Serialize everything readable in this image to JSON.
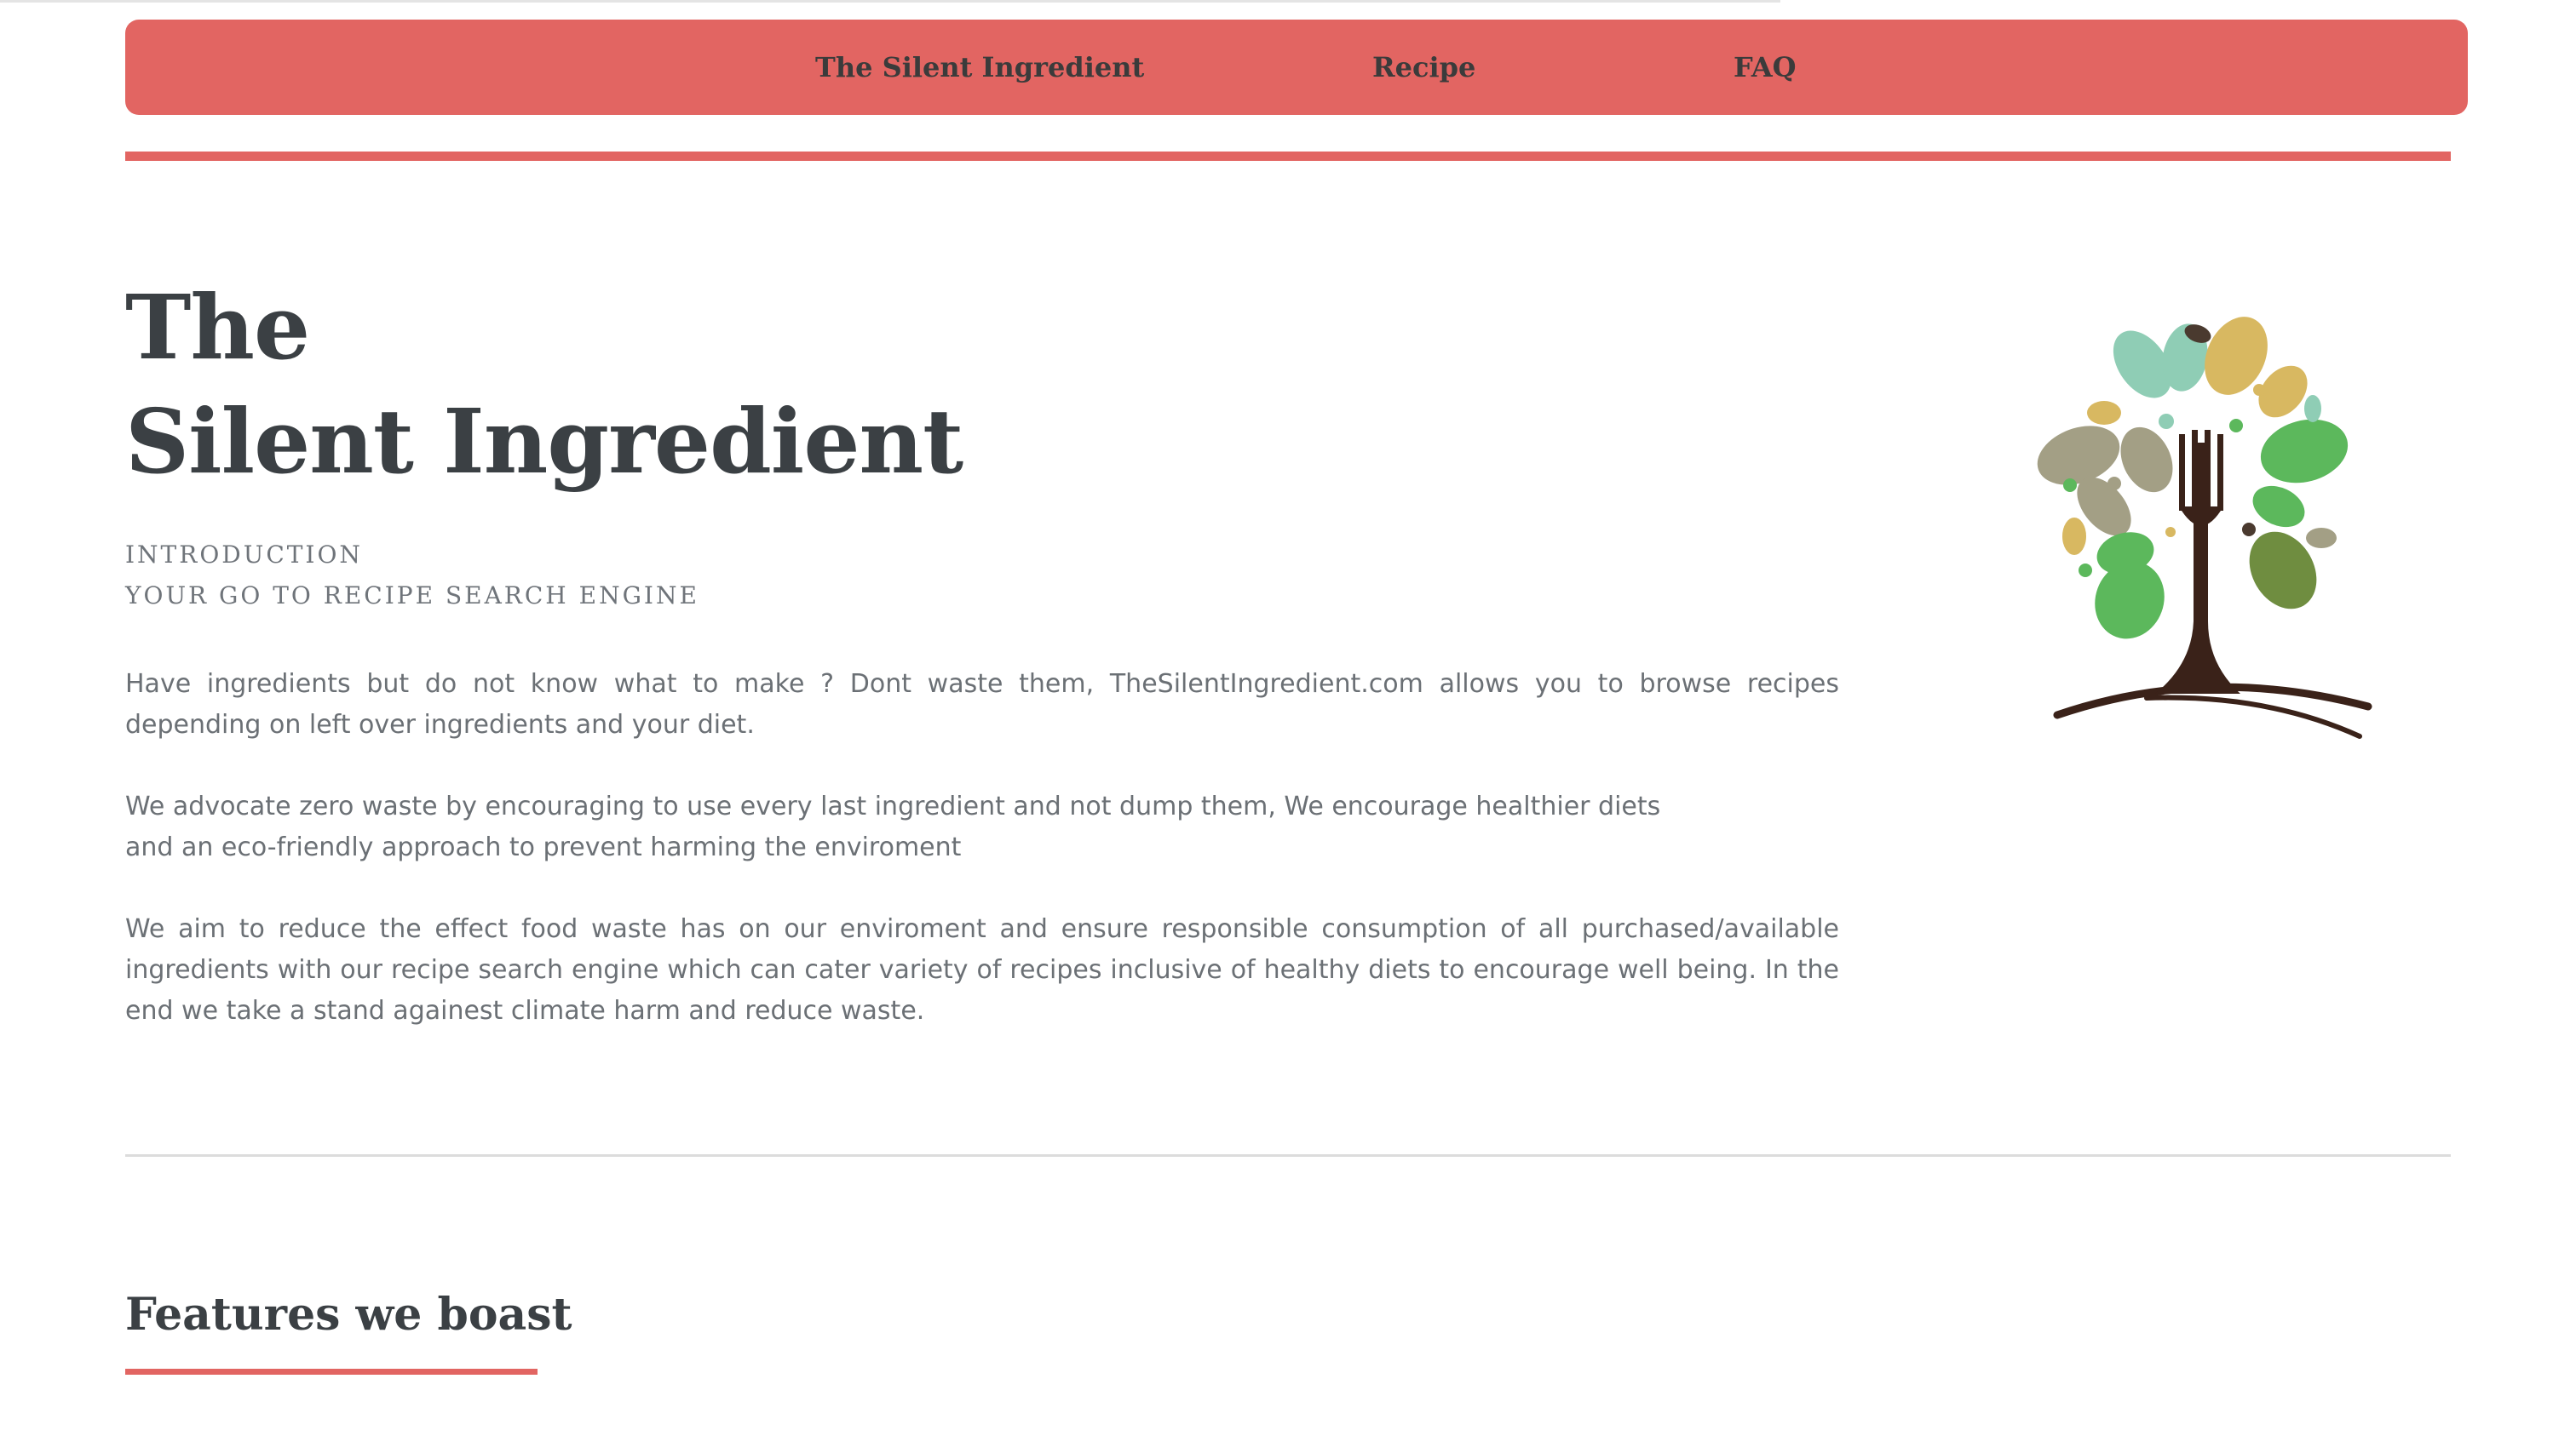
{
  "nav": {
    "links": [
      {
        "label": "The Silent Ingredient"
      },
      {
        "label": "Recipe"
      },
      {
        "label": "FAQ"
      }
    ]
  },
  "hero": {
    "title_line1": "The",
    "title_line2": "Silent Ingredient",
    "eyebrow_line1": "INTRODUCTION",
    "eyebrow_line2": "YOUR GO TO RECIPE SEARCH ENGINE",
    "paragraphs": [
      "Have ingredients but do not know what to make ? Dont waste them, TheSilentIngredient.com allows you to browse recipes depending on left over ingredients and your diet.",
      "We advocate zero waste by encouraging to use every last ingredient and not dump them, We encourage healthier diets and an eco-friendly approach to prevent harming the enviroment",
      "We aim to reduce the effect food waste has on our enviroment and ensure responsible consumption of all purchased/available ingredients with our recipe search engine which can cater variety of recipes inclusive of healthy diets to encourage well being. In the end we take a stand againest climate harm and reduce waste."
    ]
  },
  "features": {
    "heading": "Features we boast"
  },
  "logo": {
    "icon": "fork-tree-logo"
  },
  "colors": {
    "accent": "#e26562",
    "heading": "#3b4044",
    "body_text": "#6b7075",
    "divider": "#dcdcdc"
  }
}
